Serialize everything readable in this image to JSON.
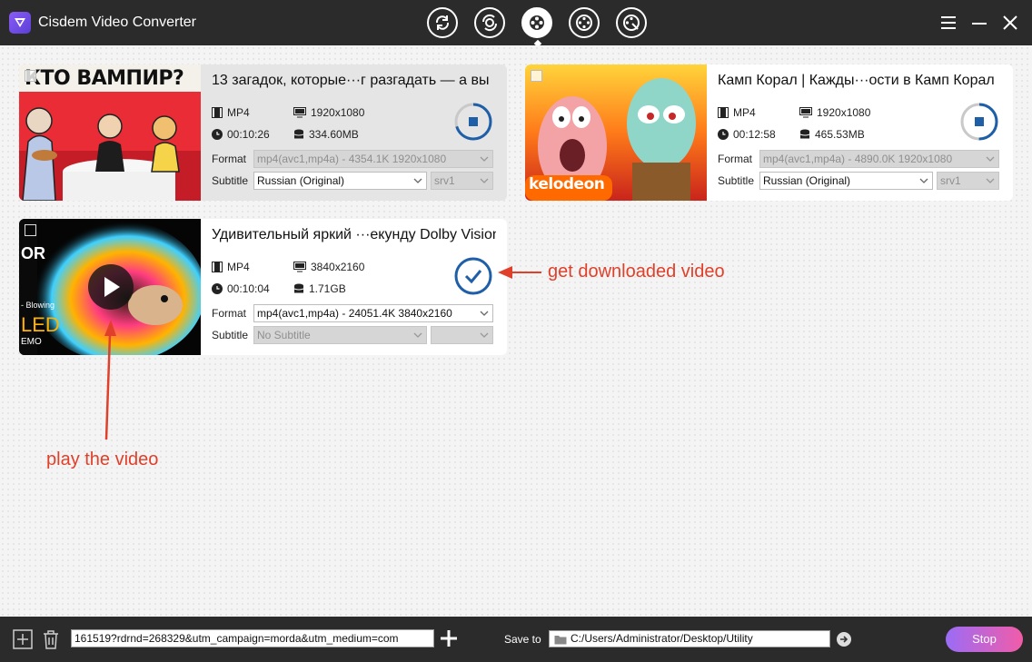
{
  "app": {
    "title": "Cisdem Video Converter"
  },
  "toolbar": {
    "modes": [
      {
        "name": "convert-mode-button",
        "icon": "convert-icon"
      },
      {
        "name": "rip-mode-button",
        "icon": "rip-icon"
      },
      {
        "name": "download-mode-button",
        "icon": "download-film-icon",
        "active": true
      },
      {
        "name": "compress-mode-button",
        "icon": "compress-film-icon"
      },
      {
        "name": "burn-mode-button",
        "icon": "burn-film-icon"
      }
    ]
  },
  "videos": [
    {
      "title": "13 загадок, которые···г разгадать — а вы",
      "thumb_text": "КТО ВАМПИР?",
      "format": "MP4",
      "resolution": "1920x1080",
      "duration": "00:10:26",
      "size": "334.60MB",
      "format_select": "mp4(avc1,mp4a) - 4354.1K 1920x1080",
      "subtitle_select": "Russian (Original)",
      "subtitle_source": "srv1",
      "status": "downloading",
      "progress": 0.3
    },
    {
      "title": "Камп Корал | Кажды···ости в Камп Корал",
      "thumb_text": "kelodeon",
      "format": "MP4",
      "resolution": "1920x1080",
      "duration": "00:12:58",
      "size": "465.53MB",
      "format_select": "mp4(avc1,mp4a) - 4890.0K 1920x1080",
      "subtitle_select": "Russian (Original)",
      "subtitle_source": "srv1",
      "status": "downloading",
      "progress": 0.5
    },
    {
      "title": "Удивительный яркий ···екунду Dolby Vision",
      "thumb_text_1": "OR",
      "thumb_text_2": "- Blowing",
      "thumb_text_3": "LED",
      "thumb_text_4": "EMO",
      "format": "MP4",
      "resolution": "3840x2160",
      "duration": "00:10:04",
      "size": "1.71GB",
      "format_select": "mp4(avc1,mp4a) - 24051.4K 3840x2160",
      "subtitle_select": "No Subtitle",
      "subtitle_source": "",
      "status": "done"
    }
  ],
  "labels": {
    "format": "Format",
    "subtitle": "Subtitle"
  },
  "annotations": {
    "downloaded": "get downloaded video",
    "play": "play the video"
  },
  "bottom": {
    "url_value": "161519?rdrnd=268329&utm_campaign=morda&utm_medium=com",
    "save_label": "Save to",
    "save_path": "C:/Users/Administrator/Desktop/Utility",
    "stop_label": "Stop"
  },
  "colors": {
    "accent_blue": "#1e5fa8",
    "annotation": "#e0402a",
    "stop_gradient_start": "#9b6cf6",
    "stop_gradient_end": "#f15ca8"
  }
}
